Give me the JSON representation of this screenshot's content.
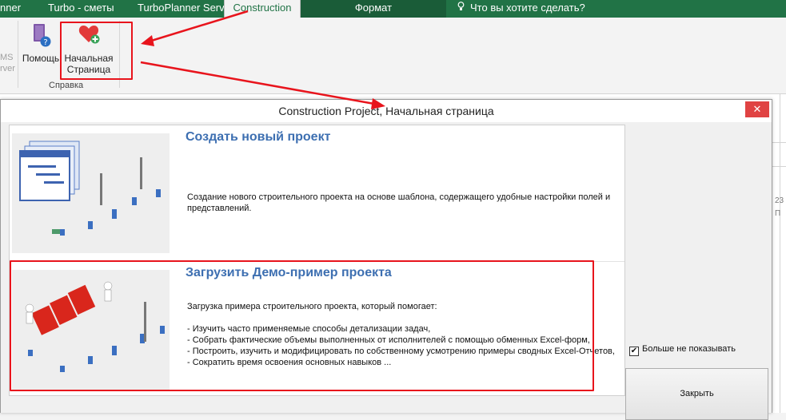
{
  "ribbon_tabs": {
    "planner": "nner",
    "turbo": "Turbo - сметы",
    "server": "TurboPlanner Server",
    "construction": "Construction",
    "format": "Формат",
    "tell_me": "Что вы хотите сделать?"
  },
  "ribbon": {
    "ghost_ms": "MS",
    "ghost_rver": "rver",
    "help_label": "Помощь",
    "start_page_line1": "Начальная",
    "start_page_line2": "Страница",
    "group_label": "Справка"
  },
  "dialog": {
    "title": "Construction Project, Начальная страница",
    "close_icon": "✕",
    "cards": [
      {
        "title": "Создать новый проект",
        "desc_lines": [
          " Создание нового строительного проекта на основе шаблона, содержащего удобные настройки полей и",
          "представлений."
        ]
      },
      {
        "title": "Загрузить Демо-пример проекта",
        "desc_lines": [
          " Загрузка примера строительного проекта, который помогает:",
          "",
          "- Изучить часто применяемые способы детализации задач,",
          "- Собрать фактические объемы  выполненных от исполнителей с помощью обменных Excel-форм,",
          "- Построить, изучить и модифицировать по собственному усмотрению примеры сводных Excel-Отчетов,",
          "- Сократить время освоения основных навыков ..."
        ]
      }
    ],
    "dont_show_label": "Больше не показывать",
    "dont_show_checked": true,
    "close_button": "Закрыть"
  },
  "sheet_side": {
    "num": "23",
    "letter": "П"
  },
  "colors": {
    "ribbon_green": "#217346",
    "annotation_red": "#e8141c",
    "title_blue": "#3d6fb1"
  },
  "icons": [
    "book-help-icon",
    "heart-plus-icon",
    "lightbulb-icon",
    "close-icon",
    "checkbox-icon"
  ]
}
